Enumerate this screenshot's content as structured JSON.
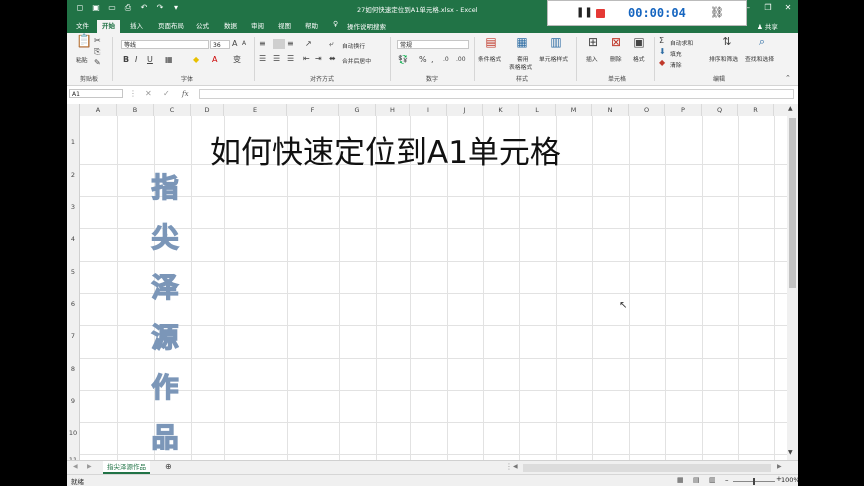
{
  "window": {
    "title": "27如何快速定位到A1单元格.xlsx - Excel",
    "login_label": "登录",
    "share_label": "共享"
  },
  "recorder": {
    "time": "00:00:04",
    "accent": "#1565c0",
    "stop_color": "#e53935"
  },
  "tabs": [
    "文件",
    "开始",
    "插入",
    "页面布局",
    "公式",
    "数据",
    "审阅",
    "视图",
    "帮助"
  ],
  "active_tab": "开始",
  "tell_me": "操作说明搜索",
  "ribbon": {
    "clipboard": {
      "paste": "粘贴",
      "label": "剪贴板"
    },
    "font": {
      "name": "等线",
      "size": "36",
      "bold": "B",
      "italic": "I",
      "underline": "U",
      "label": "字体"
    },
    "alignment": {
      "wrap": "自动换行",
      "merge": "合并后居中",
      "label": "对齐方式"
    },
    "number": {
      "format": "常规",
      "label": "数字"
    },
    "styles": {
      "conditional": "条件格式",
      "table_a": "套用",
      "table_b": "表格格式",
      "cell": "单元格样式",
      "label": "样式"
    },
    "cells": {
      "insert": "插入",
      "delete": "删除",
      "format": "格式",
      "label": "单元格"
    },
    "editing": {
      "autosum": "自动求和",
      "fill": "填充",
      "clear": "清除",
      "sort": "排序和筛选",
      "find": "查找和选择",
      "label": "编辑"
    }
  },
  "formula_bar": {
    "name_box": "A1",
    "fx": "fx",
    "value": ""
  },
  "columns": [
    "A",
    "B",
    "C",
    "D",
    "E",
    "F",
    "G",
    "H",
    "I",
    "J",
    "K",
    "L",
    "M",
    "N",
    "O",
    "P",
    "Q",
    "R"
  ],
  "rows": [
    "1",
    "2",
    "3",
    "4",
    "5",
    "6",
    "7",
    "8",
    "9",
    "10",
    "11"
  ],
  "sheet": {
    "title_text": "如何快速定位到A1单元格",
    "watermark": [
      "指",
      "尖",
      "泽",
      "源",
      "作",
      "品"
    ]
  },
  "sheet_tabs": [
    "指尖泽源作品"
  ],
  "status": {
    "ready": "就绪",
    "zoom": "100%"
  },
  "colors": {
    "excel_green": "#217346",
    "watermark_stroke": "#7b96b8"
  }
}
